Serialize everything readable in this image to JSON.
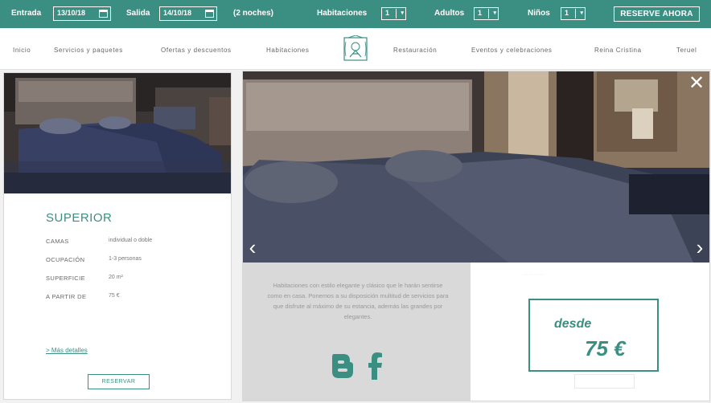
{
  "booking": {
    "checkin_label": "Entrada",
    "checkin_date": "13/10/18",
    "checkout_label": "Salida",
    "checkout_date": "14/10/18",
    "nights": "(2 noches)",
    "rooms_label": "Habitaciones",
    "rooms_value": "1",
    "adults_label": "Adultos",
    "adults_value": "1",
    "children_label": "Niños",
    "children_value": "1",
    "reserve_label": "RESERVE AHORA"
  },
  "nav": {
    "items": [
      "Inicio",
      "Servicios y paquetes",
      "Ofertas y descuentos",
      "Habitaciones",
      "Restauración",
      "Eventos y celebraciones",
      "Reina Cristina",
      "Teruel"
    ]
  },
  "room": {
    "name": "SUPERIOR",
    "specs": [
      {
        "key": "CAMAS",
        "value": "individual o doble"
      },
      {
        "key": "OCUPACIÓN",
        "value": "1-3 personas"
      },
      {
        "key": "SUPERFICIE",
        "value": "20 m²"
      },
      {
        "key": "A PARTIR DE",
        "value": "75 €"
      }
    ],
    "more_link": "> Más detalles",
    "reserve_button": "RESERVAR"
  },
  "gallery": {
    "description": "Habitaciones con estilo elegante y clásico que le harán sentirse como en casa. Ponemos a su disposición multitud de servicios para que disfrute al máximo de su estancia, además las grandes por elegantes.",
    "price_from": "desde",
    "price_value": "75 €",
    "close_icon": "close-icon",
    "prev_icon": "chevron-left-icon",
    "next_icon": "chevron-right-icon",
    "social": [
      "blogger-icon",
      "facebook-icon"
    ]
  },
  "colors": {
    "accent": "#3a8f82",
    "nav_text": "#666666"
  }
}
